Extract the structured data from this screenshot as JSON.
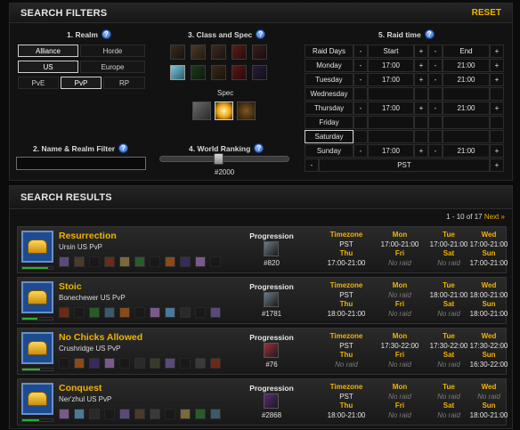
{
  "filters": {
    "title": "SEARCH FILTERS",
    "reset": "RESET",
    "realm": {
      "title": "1. Realm",
      "faction": [
        "Alliance",
        "Horde"
      ],
      "region": [
        "US",
        "Europe"
      ],
      "type": [
        "PvE",
        "PvP",
        "RP"
      ],
      "active": [
        "Alliance",
        "US",
        "PvP"
      ]
    },
    "class_spec": {
      "title": "3. Class and Spec",
      "spec_label": "Spec",
      "class_icons": [
        "warrior-icon",
        "paladin-icon",
        "hunter-icon",
        "rogue-icon",
        "priest-icon",
        "death-knight-icon",
        "shaman-icon",
        "mage-icon",
        "warlock-icon",
        "druid-icon"
      ],
      "spec_icons": [
        "discipline-spec-icon",
        "holy-spec-icon",
        "shadow-spec-icon"
      ]
    },
    "name_realm": {
      "title": "2. Name & Realm Filter",
      "value": ""
    },
    "world_ranking": {
      "title": "4. World Ranking",
      "value": "#2000",
      "level": 0.45
    },
    "raid_time": {
      "title": "5. Raid time",
      "headers": {
        "days": "Raid Days",
        "start": "Start",
        "end": "End"
      },
      "minus": "-",
      "plus": "+",
      "days": [
        {
          "name": "Monday",
          "start": "17:00",
          "end": "21:00"
        },
        {
          "name": "Tuesday",
          "start": "17:00",
          "end": "21:00"
        },
        {
          "name": "Wednesday",
          "start": "",
          "end": ""
        },
        {
          "name": "Thursday",
          "start": "17:00",
          "end": "21:00"
        },
        {
          "name": "Friday",
          "start": "",
          "end": ""
        },
        {
          "name": "Saturday",
          "start": "",
          "end": ""
        },
        {
          "name": "Sunday",
          "start": "17:00",
          "end": "21:00"
        }
      ],
      "timezone": "PST"
    }
  },
  "results": {
    "title": "SEARCH RESULTS",
    "pager": {
      "range": "1 - 10 of 17",
      "next": "Next »"
    },
    "guilds": [
      {
        "name": "Resurrection",
        "server": "Ursin US PvP",
        "progress_fill": 0.85,
        "progression_label": "Progression",
        "rank": "#820",
        "timezone_label": "Timezone",
        "timezone": "PST",
        "days": [
          {
            "label": "Mon",
            "value": "17:00-21:00"
          },
          {
            "label": "Tue",
            "value": "17:00-21:00"
          },
          {
            "label": "Wed",
            "value": "17:00-21:00"
          },
          {
            "label": "Thu",
            "value": "17:00-21:00"
          },
          {
            "label": "Fri",
            "value": "No raid"
          },
          {
            "label": "Sat",
            "value": "No raid"
          },
          {
            "label": "Sun",
            "value": "17:00-21:00"
          }
        ]
      },
      {
        "name": "Stoic",
        "server": "Bonechewer US PvP",
        "progress_fill": 0.5,
        "progression_label": "Progression",
        "rank": "#1781",
        "timezone_label": "Timezone",
        "timezone": "PST",
        "days": [
          {
            "label": "Mon",
            "value": "No raid"
          },
          {
            "label": "Tue",
            "value": "18:00-21:00"
          },
          {
            "label": "Wed",
            "value": "18:00-21:00"
          },
          {
            "label": "Thu",
            "value": "18:00-21:00"
          },
          {
            "label": "Fri",
            "value": "No raid"
          },
          {
            "label": "Sat",
            "value": "No raid"
          },
          {
            "label": "Sun",
            "value": "18:00-21:00"
          }
        ]
      },
      {
        "name": "No Chicks Allowed",
        "server": "Crushridge US PvP",
        "progress_fill": 0.6,
        "progression_label": "Progression",
        "rank": "#76",
        "timezone_label": "Timezone",
        "timezone": "PST",
        "days": [
          {
            "label": "Mon",
            "value": "17:30-22:00"
          },
          {
            "label": "Tue",
            "value": "17:30-22:00"
          },
          {
            "label": "Wed",
            "value": "17:30-22:00"
          },
          {
            "label": "Thu",
            "value": "No raid"
          },
          {
            "label": "Fri",
            "value": "No raid"
          },
          {
            "label": "Sat",
            "value": "No raid"
          },
          {
            "label": "Sun",
            "value": "16:30-22:00"
          }
        ]
      },
      {
        "name": "Conquest",
        "server": "Ner'zhul US PvP",
        "progress_fill": 0.55,
        "progression_label": "Progression",
        "rank": "#2868",
        "timezone_label": "Timezone",
        "timezone": "PST",
        "days": [
          {
            "label": "Mon",
            "value": "No raid"
          },
          {
            "label": "Tue",
            "value": "No raid"
          },
          {
            "label": "Wed",
            "value": "No raid"
          },
          {
            "label": "Thu",
            "value": "18:00-21:00"
          },
          {
            "label": "Fri",
            "value": "No raid"
          },
          {
            "label": "Sat",
            "value": "No raid"
          },
          {
            "label": "Sun",
            "value": "18:00-21:00"
          }
        ]
      }
    ]
  },
  "colors": {
    "accent": "#f0b400",
    "background": "#0b0b0b",
    "panel": "#121212",
    "progress": "#2fae2f"
  }
}
